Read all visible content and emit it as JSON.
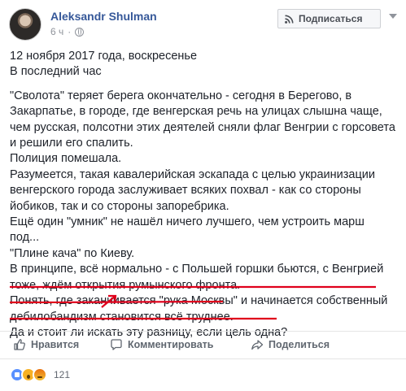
{
  "post": {
    "author": "Aleksandr Shulman",
    "time": "6 ч",
    "subscribe_label": "Подписаться"
  },
  "body": {
    "lines": [
      "12 ноября 2017 года, воскресенье",
      "В последний час",
      "",
      "\"Сволота\" теряет берега окончательно - сегодня в Берегово, в Закарпатье, в городе, где венгерская речь на улицах слышна чаще, чем русская, полсотни этих деятелей сняли флаг Венгрии с горсовета и решили его спалить.",
      "Полиция помешала.",
      "Разумеется, такая кавалерийская эскапада с целью украинизации венгерского города заслуживает всяких похвал - как со стороны йобиков, так и со стороны запоребрика.",
      "Ещё один \"умник\" не нашёл ничего лучшего, чем устроить марш под...",
      "\"Плине кача\" по Киеву.",
      "В принципе, всё нормально - с Польшей горшки бьются, с Венгрией тоже, ждём открытия румынского фронта.",
      "Понять, где заканчивается \"рука Москвы\" и начинается собственный дебилобандизм становится всё труднее.",
      "Да и стоит ли искать эту разницу, если цель одна?"
    ]
  },
  "actions": {
    "like_label": "Нравится",
    "comment_label": "Комментировать",
    "share_label": "Поделиться"
  },
  "reactions": {
    "types": [
      "like",
      "wow",
      "angry"
    ],
    "count": "121"
  },
  "colors": {
    "link_blue": "#365899",
    "annotation_red": "#e0001b",
    "meta_gray": "#90949c"
  }
}
